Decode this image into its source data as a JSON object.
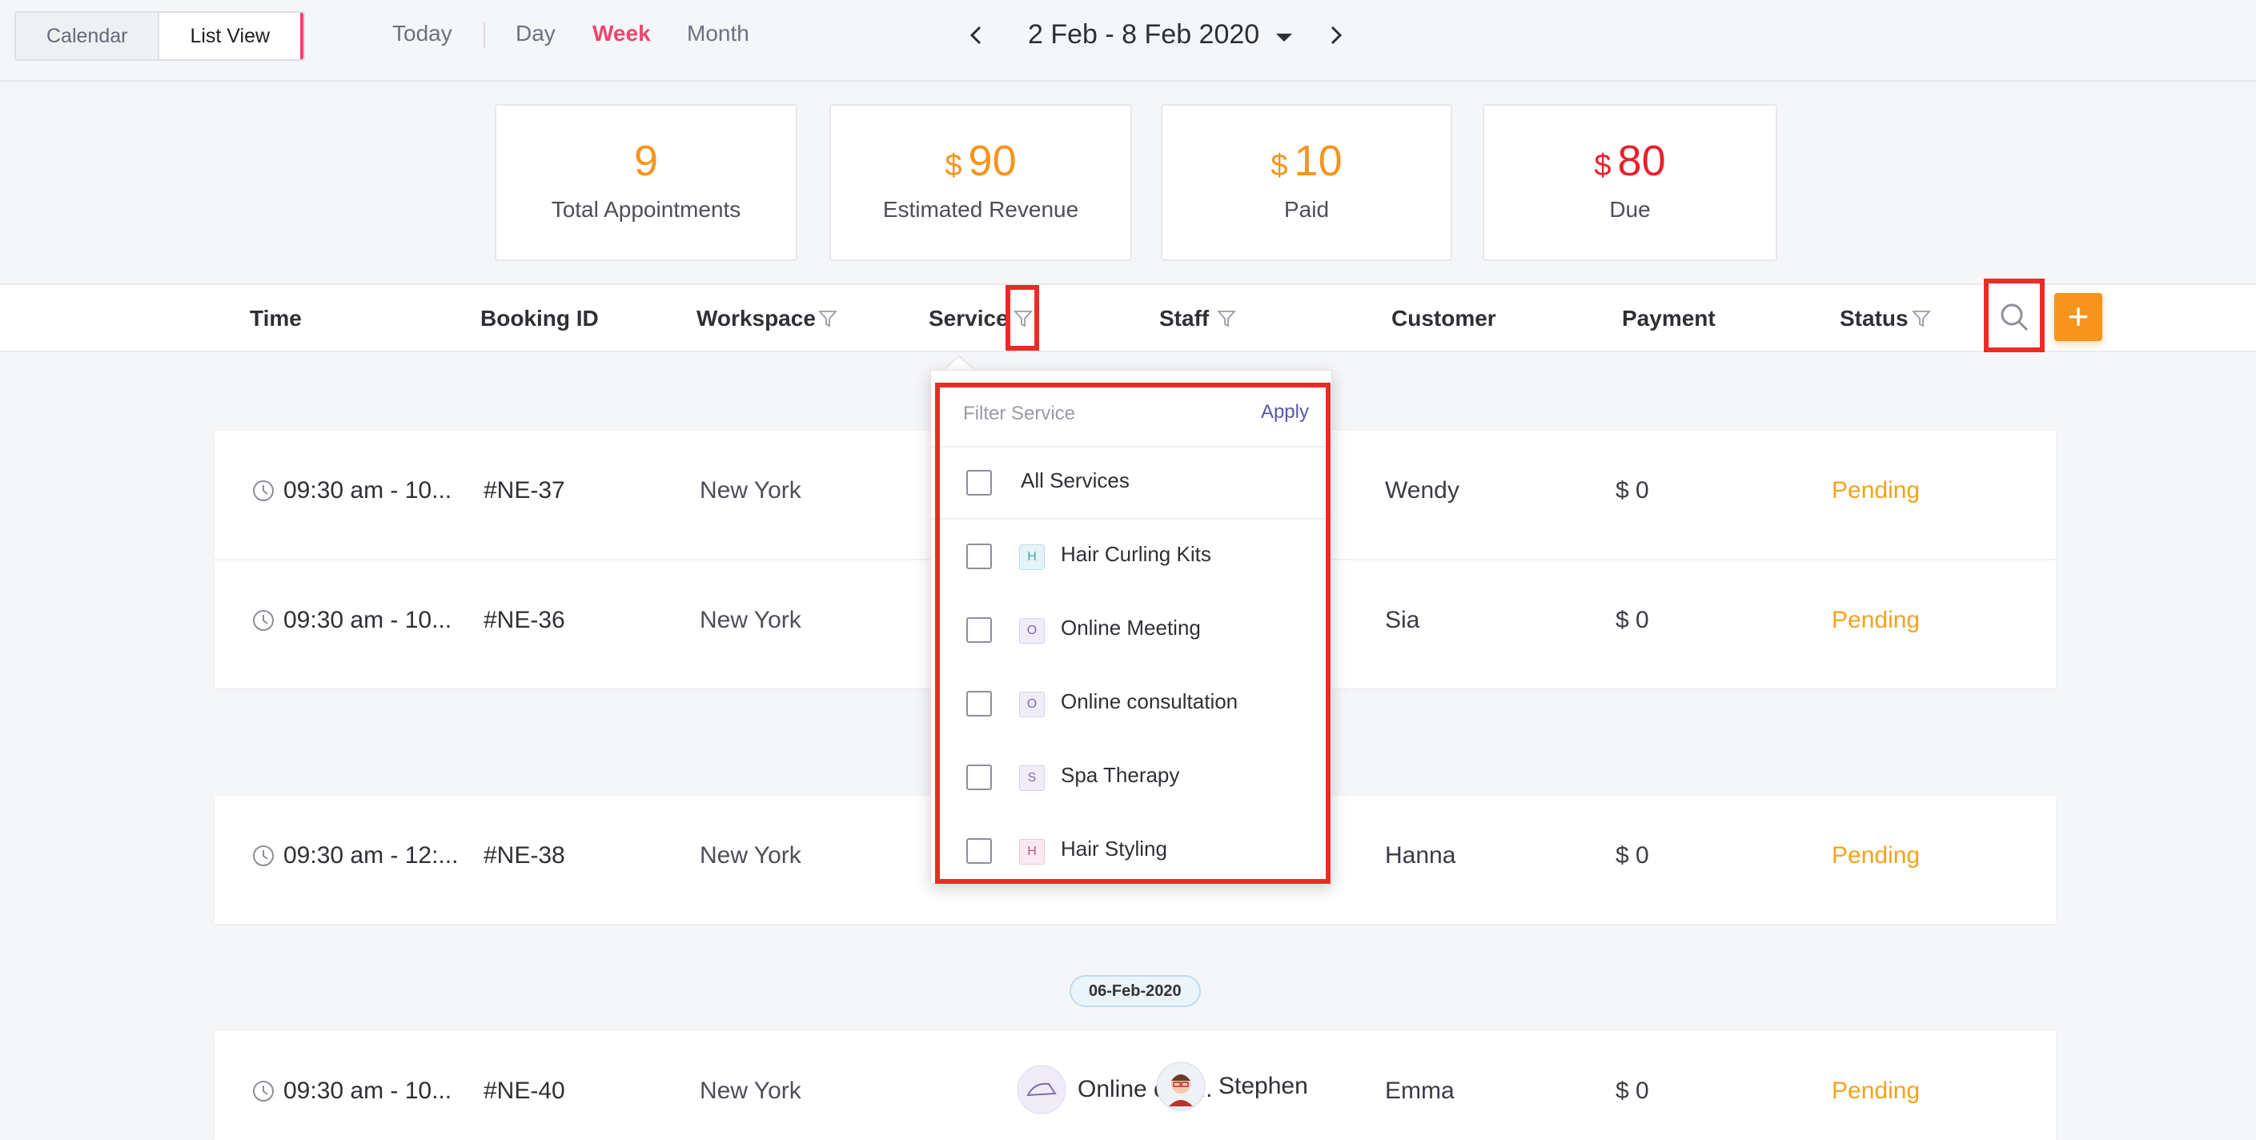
{
  "view_toggle": {
    "calendar": "Calendar",
    "list": "List View"
  },
  "nav": {
    "today": "Today",
    "day": "Day",
    "week": "Week",
    "month": "Month"
  },
  "date_range": "2 Feb - 8 Feb 2020",
  "stats": [
    {
      "value": "9",
      "label": "Total Appointments",
      "currency": ""
    },
    {
      "value": "90",
      "label": "Estimated Revenue",
      "currency": "$"
    },
    {
      "value": "10",
      "label": "Paid",
      "currency": "$"
    },
    {
      "value": "80",
      "label": "Due",
      "currency": "$"
    }
  ],
  "columns": {
    "time": "Time",
    "booking_id": "Booking ID",
    "workspace": "Workspace",
    "service": "Service",
    "staff": "Staff",
    "customer": "Customer",
    "payment": "Payment",
    "status": "Status"
  },
  "rows": [
    {
      "time": "09:30 am - 10...",
      "id": "#NE-37",
      "workspace": "New York",
      "customer": "Wendy",
      "payment": "$ 0",
      "status": "Pending"
    },
    {
      "time": "09:30 am - 10...",
      "id": "#NE-36",
      "workspace": "New York",
      "customer": "Sia",
      "payment": "$ 0",
      "status": "Pending"
    },
    {
      "time": "09:30 am - 12:...",
      "id": "#NE-38",
      "workspace": "New York",
      "customer": "Hanna",
      "payment": "$ 0",
      "status": "Pending"
    },
    {
      "time": "09:30 am - 10...",
      "id": "#NE-40",
      "workspace": "New York",
      "service": "Online con...",
      "staff": "Stephen",
      "customer": "Emma",
      "payment": "$ 0",
      "status": "Pending"
    }
  ],
  "date_separator": "06-Feb-2020",
  "filter_dropdown": {
    "placeholder": "Filter Service",
    "apply": "Apply",
    "all": "All Services",
    "items": [
      {
        "initial": "H",
        "label": "Hair Curling Kits"
      },
      {
        "initial": "O",
        "label": "Online Meeting"
      },
      {
        "initial": "O",
        "label": "Online consultation"
      },
      {
        "initial": "S",
        "label": "Spa Therapy"
      },
      {
        "initial": "H",
        "label": "Hair Styling"
      }
    ]
  },
  "colors": {
    "accent": "#f0456d",
    "orange": "#f7941d",
    "due_red": "#e8212c",
    "pending": "#f4a21c",
    "highlight": "#ee2a24"
  }
}
